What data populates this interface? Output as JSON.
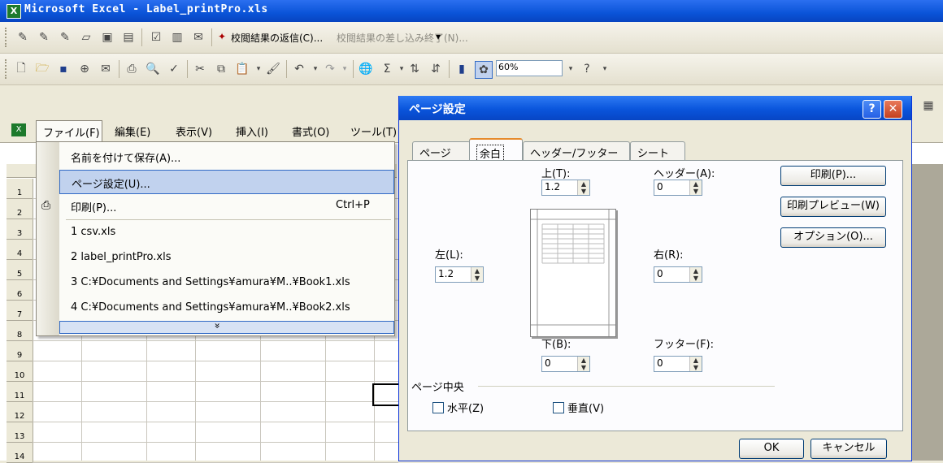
{
  "window": {
    "title": "Microsoft Excel - Label_printPro.xls"
  },
  "reviewing_toolbar": {
    "reply_label": "校閲結果の返信(C)...",
    "end_label": "校閲結果の差し込み終了(N)..."
  },
  "standard_toolbar": {
    "zoom": "60%"
  },
  "menubar": {
    "items": [
      "ファイル(F)",
      "編集(E)",
      "表示(V)",
      "挿入(I)",
      "書式(O)",
      "ツール(T)"
    ]
  },
  "file_menu": {
    "items": [
      {
        "label": "名前を付けて保存(A)...",
        "shortcut": ""
      },
      {
        "label": "ページ設定(U)...",
        "shortcut": ""
      },
      {
        "label": "印刷(P)...",
        "shortcut": "Ctrl+P"
      },
      {
        "label": "1 csv.xls",
        "shortcut": ""
      },
      {
        "label": "2 label_printPro.xls",
        "shortcut": ""
      },
      {
        "label": "3 C:¥Documents and Settings¥amura¥M..¥Book1.xls",
        "shortcut": ""
      },
      {
        "label": "4 C:¥Documents and Settings¥amura¥M..¥Book2.xls",
        "shortcut": ""
      }
    ],
    "more_glyph": "»"
  },
  "sheet": {
    "row_numbers": [
      "1",
      "2",
      "3",
      "4",
      "5",
      "6",
      "7",
      "8",
      "9",
      "10",
      "11",
      "12",
      "13",
      "14"
    ]
  },
  "dialog": {
    "title": "ページ設定",
    "tabs": [
      "ページ",
      "余白",
      "ヘッダー/フッター",
      "シート"
    ],
    "active_tab": "余白",
    "margins": {
      "top": {
        "label": "上(T):",
        "value": "1.2"
      },
      "header": {
        "label": "ヘッダー(A):",
        "value": "0"
      },
      "left": {
        "label": "左(L):",
        "value": "1.2"
      },
      "right": {
        "label": "右(R):",
        "value": "0"
      },
      "bottom": {
        "label": "下(B):",
        "value": "0"
      },
      "footer": {
        "label": "フッター(F):",
        "value": "0"
      }
    },
    "center_group": {
      "title": "ページ中央",
      "horizontal": "水平(Z)",
      "vertical": "垂直(V)"
    },
    "buttons": {
      "print": "印刷(P)...",
      "preview": "印刷プレビュー(W)",
      "options": "オプション(O)...",
      "ok": "OK",
      "cancel": "キャンセル"
    }
  },
  "colors": {
    "titlebar": "#0a54d8",
    "menu_highlight": "#c1d2ee",
    "tab_accent": "#e68b2c"
  }
}
